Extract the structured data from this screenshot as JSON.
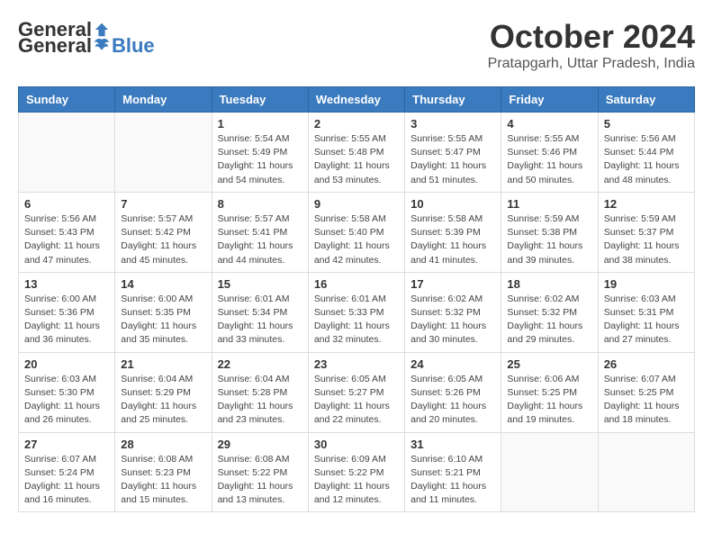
{
  "logo": {
    "general": "General",
    "blue": "Blue"
  },
  "title": "October 2024",
  "location": "Pratapgarh, Uttar Pradesh, India",
  "weekdays": [
    "Sunday",
    "Monday",
    "Tuesday",
    "Wednesday",
    "Thursday",
    "Friday",
    "Saturday"
  ],
  "weeks": [
    [
      {
        "day": "",
        "info": ""
      },
      {
        "day": "",
        "info": ""
      },
      {
        "day": "1",
        "info": "Sunrise: 5:54 AM\nSunset: 5:49 PM\nDaylight: 11 hours\nand 54 minutes."
      },
      {
        "day": "2",
        "info": "Sunrise: 5:55 AM\nSunset: 5:48 PM\nDaylight: 11 hours\nand 53 minutes."
      },
      {
        "day": "3",
        "info": "Sunrise: 5:55 AM\nSunset: 5:47 PM\nDaylight: 11 hours\nand 51 minutes."
      },
      {
        "day": "4",
        "info": "Sunrise: 5:55 AM\nSunset: 5:46 PM\nDaylight: 11 hours\nand 50 minutes."
      },
      {
        "day": "5",
        "info": "Sunrise: 5:56 AM\nSunset: 5:44 PM\nDaylight: 11 hours\nand 48 minutes."
      }
    ],
    [
      {
        "day": "6",
        "info": "Sunrise: 5:56 AM\nSunset: 5:43 PM\nDaylight: 11 hours\nand 47 minutes."
      },
      {
        "day": "7",
        "info": "Sunrise: 5:57 AM\nSunset: 5:42 PM\nDaylight: 11 hours\nand 45 minutes."
      },
      {
        "day": "8",
        "info": "Sunrise: 5:57 AM\nSunset: 5:41 PM\nDaylight: 11 hours\nand 44 minutes."
      },
      {
        "day": "9",
        "info": "Sunrise: 5:58 AM\nSunset: 5:40 PM\nDaylight: 11 hours\nand 42 minutes."
      },
      {
        "day": "10",
        "info": "Sunrise: 5:58 AM\nSunset: 5:39 PM\nDaylight: 11 hours\nand 41 minutes."
      },
      {
        "day": "11",
        "info": "Sunrise: 5:59 AM\nSunset: 5:38 PM\nDaylight: 11 hours\nand 39 minutes."
      },
      {
        "day": "12",
        "info": "Sunrise: 5:59 AM\nSunset: 5:37 PM\nDaylight: 11 hours\nand 38 minutes."
      }
    ],
    [
      {
        "day": "13",
        "info": "Sunrise: 6:00 AM\nSunset: 5:36 PM\nDaylight: 11 hours\nand 36 minutes."
      },
      {
        "day": "14",
        "info": "Sunrise: 6:00 AM\nSunset: 5:35 PM\nDaylight: 11 hours\nand 35 minutes."
      },
      {
        "day": "15",
        "info": "Sunrise: 6:01 AM\nSunset: 5:34 PM\nDaylight: 11 hours\nand 33 minutes."
      },
      {
        "day": "16",
        "info": "Sunrise: 6:01 AM\nSunset: 5:33 PM\nDaylight: 11 hours\nand 32 minutes."
      },
      {
        "day": "17",
        "info": "Sunrise: 6:02 AM\nSunset: 5:32 PM\nDaylight: 11 hours\nand 30 minutes."
      },
      {
        "day": "18",
        "info": "Sunrise: 6:02 AM\nSunset: 5:32 PM\nDaylight: 11 hours\nand 29 minutes."
      },
      {
        "day": "19",
        "info": "Sunrise: 6:03 AM\nSunset: 5:31 PM\nDaylight: 11 hours\nand 27 minutes."
      }
    ],
    [
      {
        "day": "20",
        "info": "Sunrise: 6:03 AM\nSunset: 5:30 PM\nDaylight: 11 hours\nand 26 minutes."
      },
      {
        "day": "21",
        "info": "Sunrise: 6:04 AM\nSunset: 5:29 PM\nDaylight: 11 hours\nand 25 minutes."
      },
      {
        "day": "22",
        "info": "Sunrise: 6:04 AM\nSunset: 5:28 PM\nDaylight: 11 hours\nand 23 minutes."
      },
      {
        "day": "23",
        "info": "Sunrise: 6:05 AM\nSunset: 5:27 PM\nDaylight: 11 hours\nand 22 minutes."
      },
      {
        "day": "24",
        "info": "Sunrise: 6:05 AM\nSunset: 5:26 PM\nDaylight: 11 hours\nand 20 minutes."
      },
      {
        "day": "25",
        "info": "Sunrise: 6:06 AM\nSunset: 5:25 PM\nDaylight: 11 hours\nand 19 minutes."
      },
      {
        "day": "26",
        "info": "Sunrise: 6:07 AM\nSunset: 5:25 PM\nDaylight: 11 hours\nand 18 minutes."
      }
    ],
    [
      {
        "day": "27",
        "info": "Sunrise: 6:07 AM\nSunset: 5:24 PM\nDaylight: 11 hours\nand 16 minutes."
      },
      {
        "day": "28",
        "info": "Sunrise: 6:08 AM\nSunset: 5:23 PM\nDaylight: 11 hours\nand 15 minutes."
      },
      {
        "day": "29",
        "info": "Sunrise: 6:08 AM\nSunset: 5:22 PM\nDaylight: 11 hours\nand 13 minutes."
      },
      {
        "day": "30",
        "info": "Sunrise: 6:09 AM\nSunset: 5:22 PM\nDaylight: 11 hours\nand 12 minutes."
      },
      {
        "day": "31",
        "info": "Sunrise: 6:10 AM\nSunset: 5:21 PM\nDaylight: 11 hours\nand 11 minutes."
      },
      {
        "day": "",
        "info": ""
      },
      {
        "day": "",
        "info": ""
      }
    ]
  ]
}
